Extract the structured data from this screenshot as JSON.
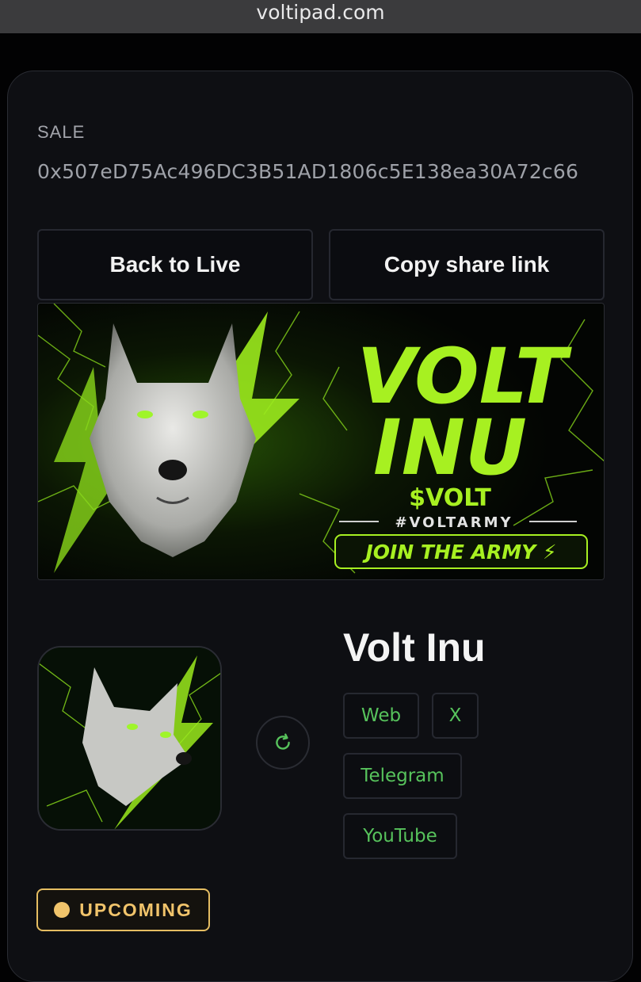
{
  "browser": {
    "url": "voltipad.com"
  },
  "sale": {
    "label": "SALE",
    "address": "0x507eD75Ac496DC3B51AD1806c5E138ea30A72c66"
  },
  "actions": {
    "back_label": "Back to Live",
    "copy_label": "Copy share link"
  },
  "banner": {
    "title_line1": "VOLT",
    "title_line2": "INU",
    "ticker": "$VOLT",
    "hashtag": "#VOLTARMY",
    "cta": "JOIN THE ARMY ⚡"
  },
  "token": {
    "name": "Volt Inu",
    "links": [
      "Web",
      "X",
      "Telegram",
      "YouTube"
    ]
  },
  "status": {
    "label": "UPCOMING",
    "color": "#f1c46b"
  },
  "theme": {
    "accent_green": "#a7f021",
    "link_green": "#57c35c",
    "panel": "#0e0f13"
  }
}
